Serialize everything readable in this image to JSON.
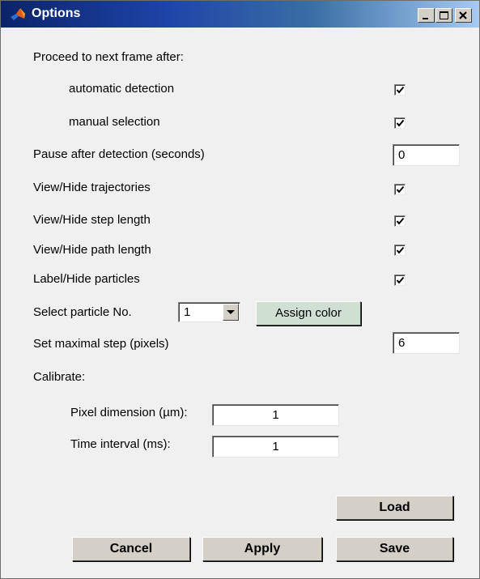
{
  "window": {
    "title": "Options",
    "icon": "matlab-logo-icon",
    "titlebar_color": "#0a246a"
  },
  "proceed": {
    "label": "Proceed to next frame after:",
    "automatic_detection": {
      "label": "automatic detection",
      "checked": true
    },
    "manual_selection": {
      "label": "manual selection",
      "checked": true
    }
  },
  "pause": {
    "label": "Pause after detection (seconds)",
    "value": "0"
  },
  "view_trajectories": {
    "label": "View/Hide trajectories",
    "checked": true
  },
  "view_step_length": {
    "label": "View/Hide step length",
    "checked": true
  },
  "view_path_length": {
    "label": "View/Hide path length",
    "checked": true
  },
  "label_particles": {
    "label": "Label/Hide particles",
    "checked": true
  },
  "particle": {
    "label": "Select particle No.",
    "selected": "1",
    "assign_color_label": "Assign color",
    "assign_color_bg": "#cfe0d2"
  },
  "max_step": {
    "label": "Set maximal step (pixels)",
    "value": "6"
  },
  "calibrate": {
    "label": "Calibrate:",
    "pixel_dimension": {
      "label": "Pixel dimension (µm):",
      "value": "1"
    },
    "time_interval": {
      "label": "Time interval (ms):",
      "value": "1"
    }
  },
  "buttons": {
    "load": "Load",
    "cancel": "Cancel",
    "apply": "Apply",
    "save": "Save"
  }
}
